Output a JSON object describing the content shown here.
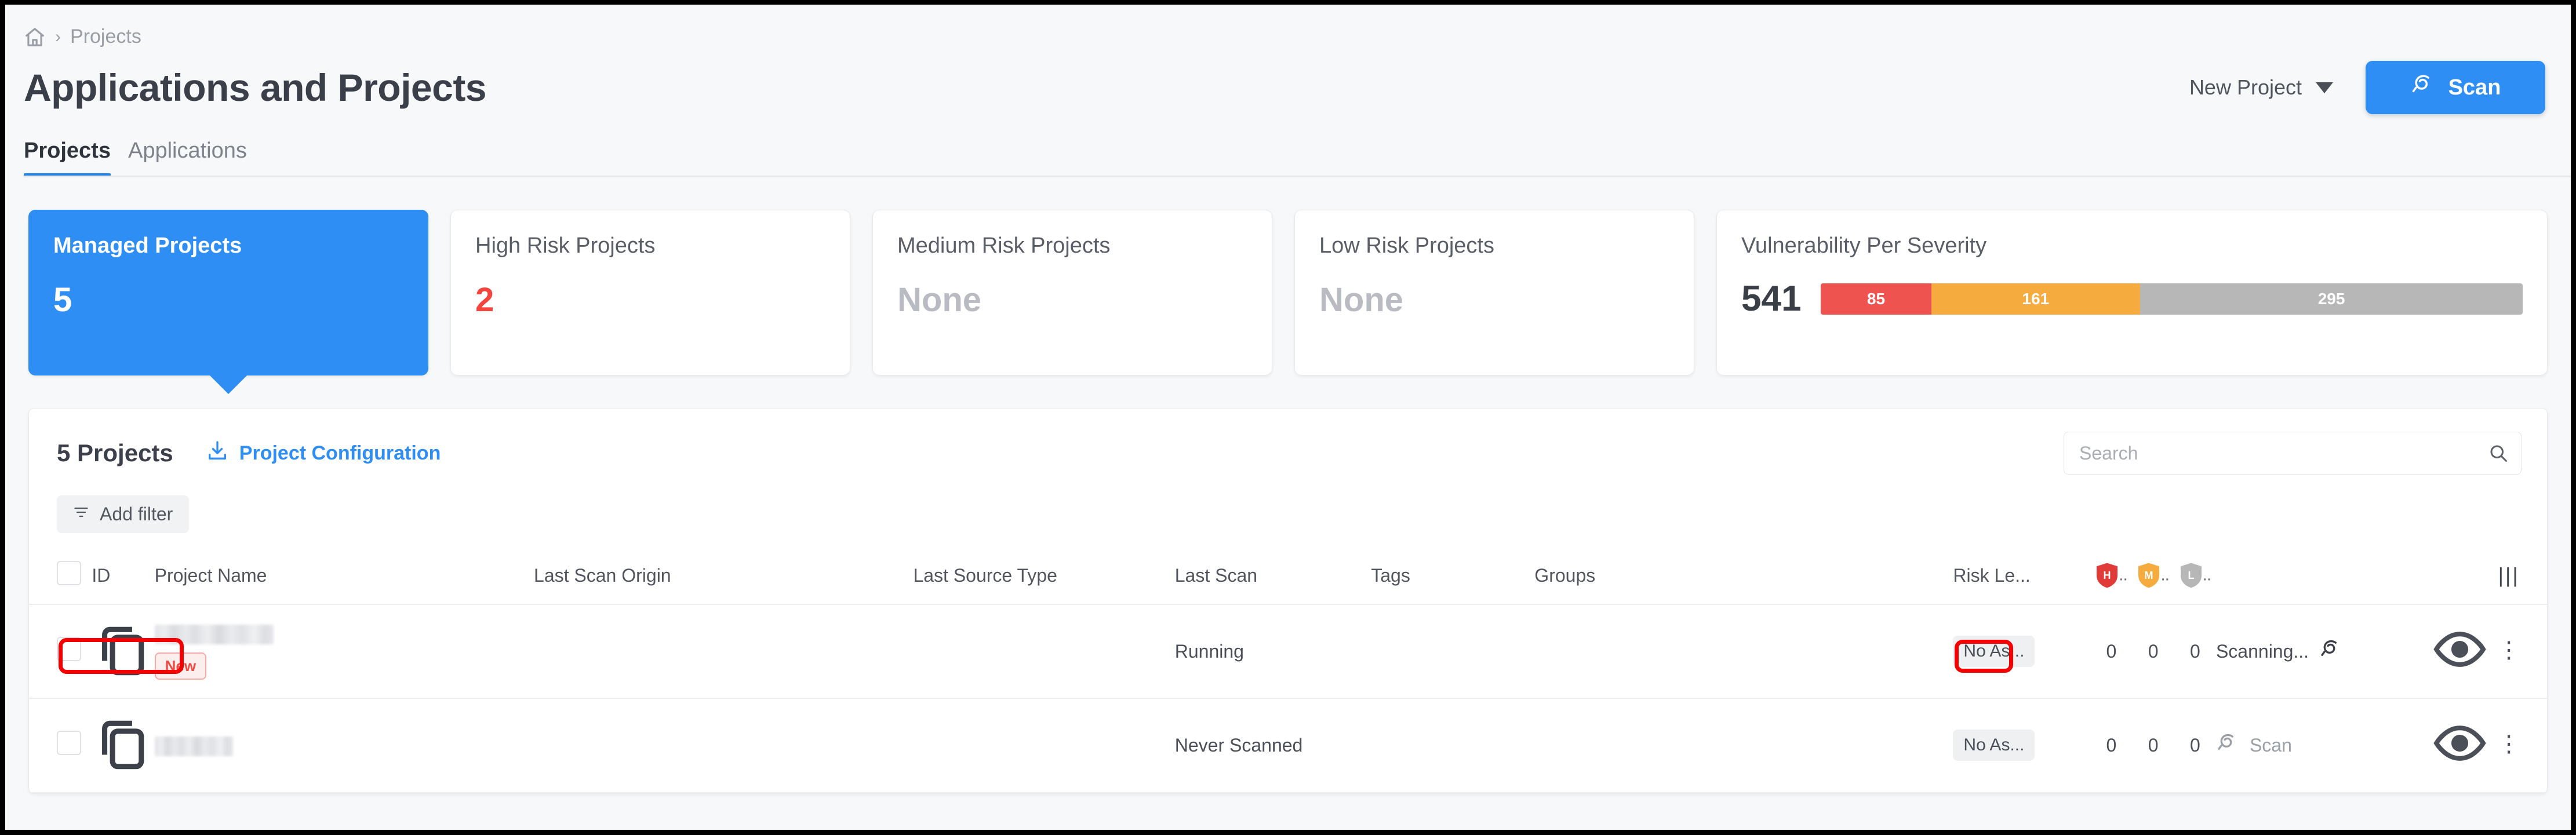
{
  "breadcrumb": {
    "home_icon": "home-icon",
    "separator": "›",
    "current": "Projects"
  },
  "header": {
    "title": "Applications and Projects",
    "new_project_label": "New Project",
    "scan_button_label": "Scan"
  },
  "tabs": [
    {
      "label": "Projects",
      "active": true
    },
    {
      "label": "Applications",
      "active": false
    }
  ],
  "cards": [
    {
      "label": "Managed Projects",
      "value": "5",
      "style": "selected"
    },
    {
      "label": "High Risk Projects",
      "value": "2",
      "style": "red"
    },
    {
      "label": "Medium Risk Projects",
      "value": "None",
      "style": "none"
    },
    {
      "label": "Low Risk Projects",
      "value": "None",
      "style": "none"
    }
  ],
  "severity_card": {
    "label": "Vulnerability Per Severity",
    "total": "541",
    "segments": [
      {
        "name": "high",
        "value": "85",
        "color": "#ef5350",
        "pct": 15.7
      },
      {
        "name": "medium",
        "value": "161",
        "color": "#f6ab3e",
        "pct": 29.8
      },
      {
        "name": "low",
        "value": "295",
        "color": "#b7b7b7",
        "pct": 54.5
      }
    ]
  },
  "chart_data": {
    "type": "bar",
    "title": "Vulnerability Per Severity",
    "categories": [
      "High",
      "Medium",
      "Low"
    ],
    "values": [
      85,
      161,
      295
    ],
    "total": 541,
    "colors": [
      "#ef5350",
      "#f6ab3e",
      "#b7b7b7"
    ],
    "orientation": "horizontal-stacked",
    "xlabel": "",
    "ylabel": "",
    "grid": false,
    "legend": "none"
  },
  "panel": {
    "count_label": "5 Projects",
    "project_configuration_label": "Project Configuration",
    "add_filter_label": "Add filter",
    "search_placeholder": "Search",
    "search_value": ""
  },
  "table": {
    "columns": [
      "",
      "ID",
      "Project Name",
      "Last Scan Origin",
      "Last Source Type",
      "Last Scan",
      "Tags",
      "Groups",
      "Risk Le...",
      "H..",
      "M..",
      "L..",
      "",
      "",
      ""
    ],
    "severity_headers": [
      {
        "letter": "H",
        "color": "#e03b38",
        "suffix": ".."
      },
      {
        "letter": "M",
        "color": "#f6ab3e",
        "suffix": ".."
      },
      {
        "letter": "L",
        "color": "#b7b7b7",
        "suffix": ".."
      }
    ],
    "column_settings_icon": "columns-icon",
    "rows": [
      {
        "checkbox": false,
        "id_icon": "copy-icon",
        "project_name": "",
        "project_name_redacted": true,
        "project_name_width": 205,
        "badge": "New",
        "last_scan_origin": "",
        "last_source_type": "",
        "last_scan": "Running",
        "tags": "",
        "groups": "",
        "risk_level": "No As...",
        "sev_high": "0",
        "sev_medium": "0",
        "sev_low": "0",
        "action_label": "Scanning...",
        "action_icon": "scan-progress-icon",
        "action_muted": false,
        "eye_icon": "eye-icon",
        "menu_icon": "kebab-menu-icon"
      },
      {
        "checkbox": false,
        "id_icon": "copy-icon",
        "project_name": "",
        "project_name_redacted": true,
        "project_name_width": 135,
        "badge": "",
        "last_scan_origin": "",
        "last_source_type": "",
        "last_scan": "Never Scanned",
        "tags": "",
        "groups": "",
        "risk_level": "No As...",
        "sev_high": "0",
        "sev_medium": "0",
        "sev_low": "0",
        "action_label": "Scan",
        "action_icon": "scan-icon",
        "action_muted": true,
        "eye_icon": "eye-icon",
        "menu_icon": "kebab-menu-icon"
      }
    ]
  },
  "annotations": [
    {
      "name": "project-name-highlight",
      "color": "#f40000"
    },
    {
      "name": "scanning-status-highlight",
      "color": "#f40000"
    }
  ]
}
